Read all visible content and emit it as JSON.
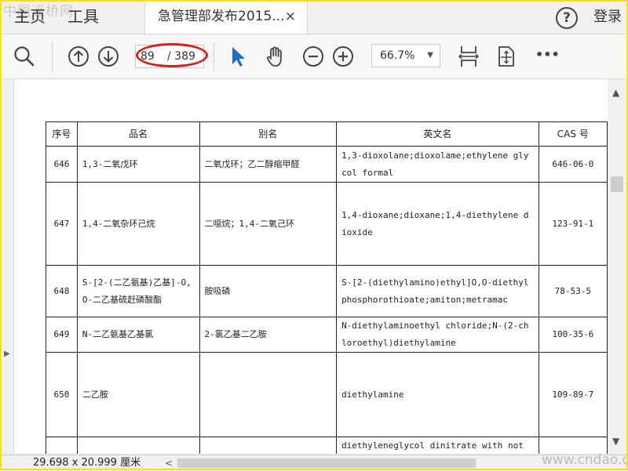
{
  "watermark_top": "中国遥桥网",
  "watermark_bottom": "www.cndao.com",
  "tabs": {
    "home": "主页",
    "tools": "工具",
    "document_title": "急管理部发布2015...",
    "close_symbol": "×"
  },
  "header": {
    "help_symbol": "?",
    "login": "登录"
  },
  "toolbar": {
    "current_page": "89",
    "total_pages": "/ 389",
    "zoom": "66.7%",
    "zoom_caret": "▼",
    "more": "•••"
  },
  "table": {
    "headers": [
      "序号",
      "品名",
      "别名",
      "英文名",
      "CAS 号"
    ],
    "rows": [
      {
        "no": "646",
        "name": "1,3-二氧戊环",
        "alias": "二氧戊环；乙二醇缩甲醛",
        "english": "1,3-dioxolane;dioxolame;ethylene glycol formal",
        "cas": "646-06-0"
      },
      {
        "no": "647",
        "name": "1,4-二氧杂环己烷",
        "alias": "二噁烷；1,4-二氧己环",
        "english": "1,4-dioxane;dioxane;1,4-diethylene dioxide",
        "cas": "123-91-1"
      },
      {
        "no": "648",
        "name": "S-[2-(二乙氨基)乙基]-O,O-二乙基硫赶磷酸酯",
        "alias": "胺吸磷",
        "english": "S-[2-(diethylamino)ethyl]O,O-diethylphosphorothioate;amiton;metramac",
        "cas": "78-53-5"
      },
      {
        "no": "649",
        "name": "N-二乙氨基乙基氯",
        "alias": "2-氯乙基二乙胺",
        "english": "N-diethylaminoethyl chloride;N-(2-chloroethyl)diethylamine",
        "cas": "100-35-6"
      },
      {
        "no": "650",
        "name": "二乙胺",
        "alias": "",
        "english": "diethylamine",
        "cas": "109-89-7"
      },
      {
        "no": "",
        "name": "",
        "alias": "",
        "english": "diethyleneglycol dinitrate with not less",
        "cas": ""
      }
    ]
  },
  "status": {
    "dimensions": "29.698 x 20.999 厘米",
    "scroll_left": "<"
  },
  "scrollbar": {
    "up": "▲",
    "down": "▼",
    "left_panel_arrow": "▶"
  }
}
